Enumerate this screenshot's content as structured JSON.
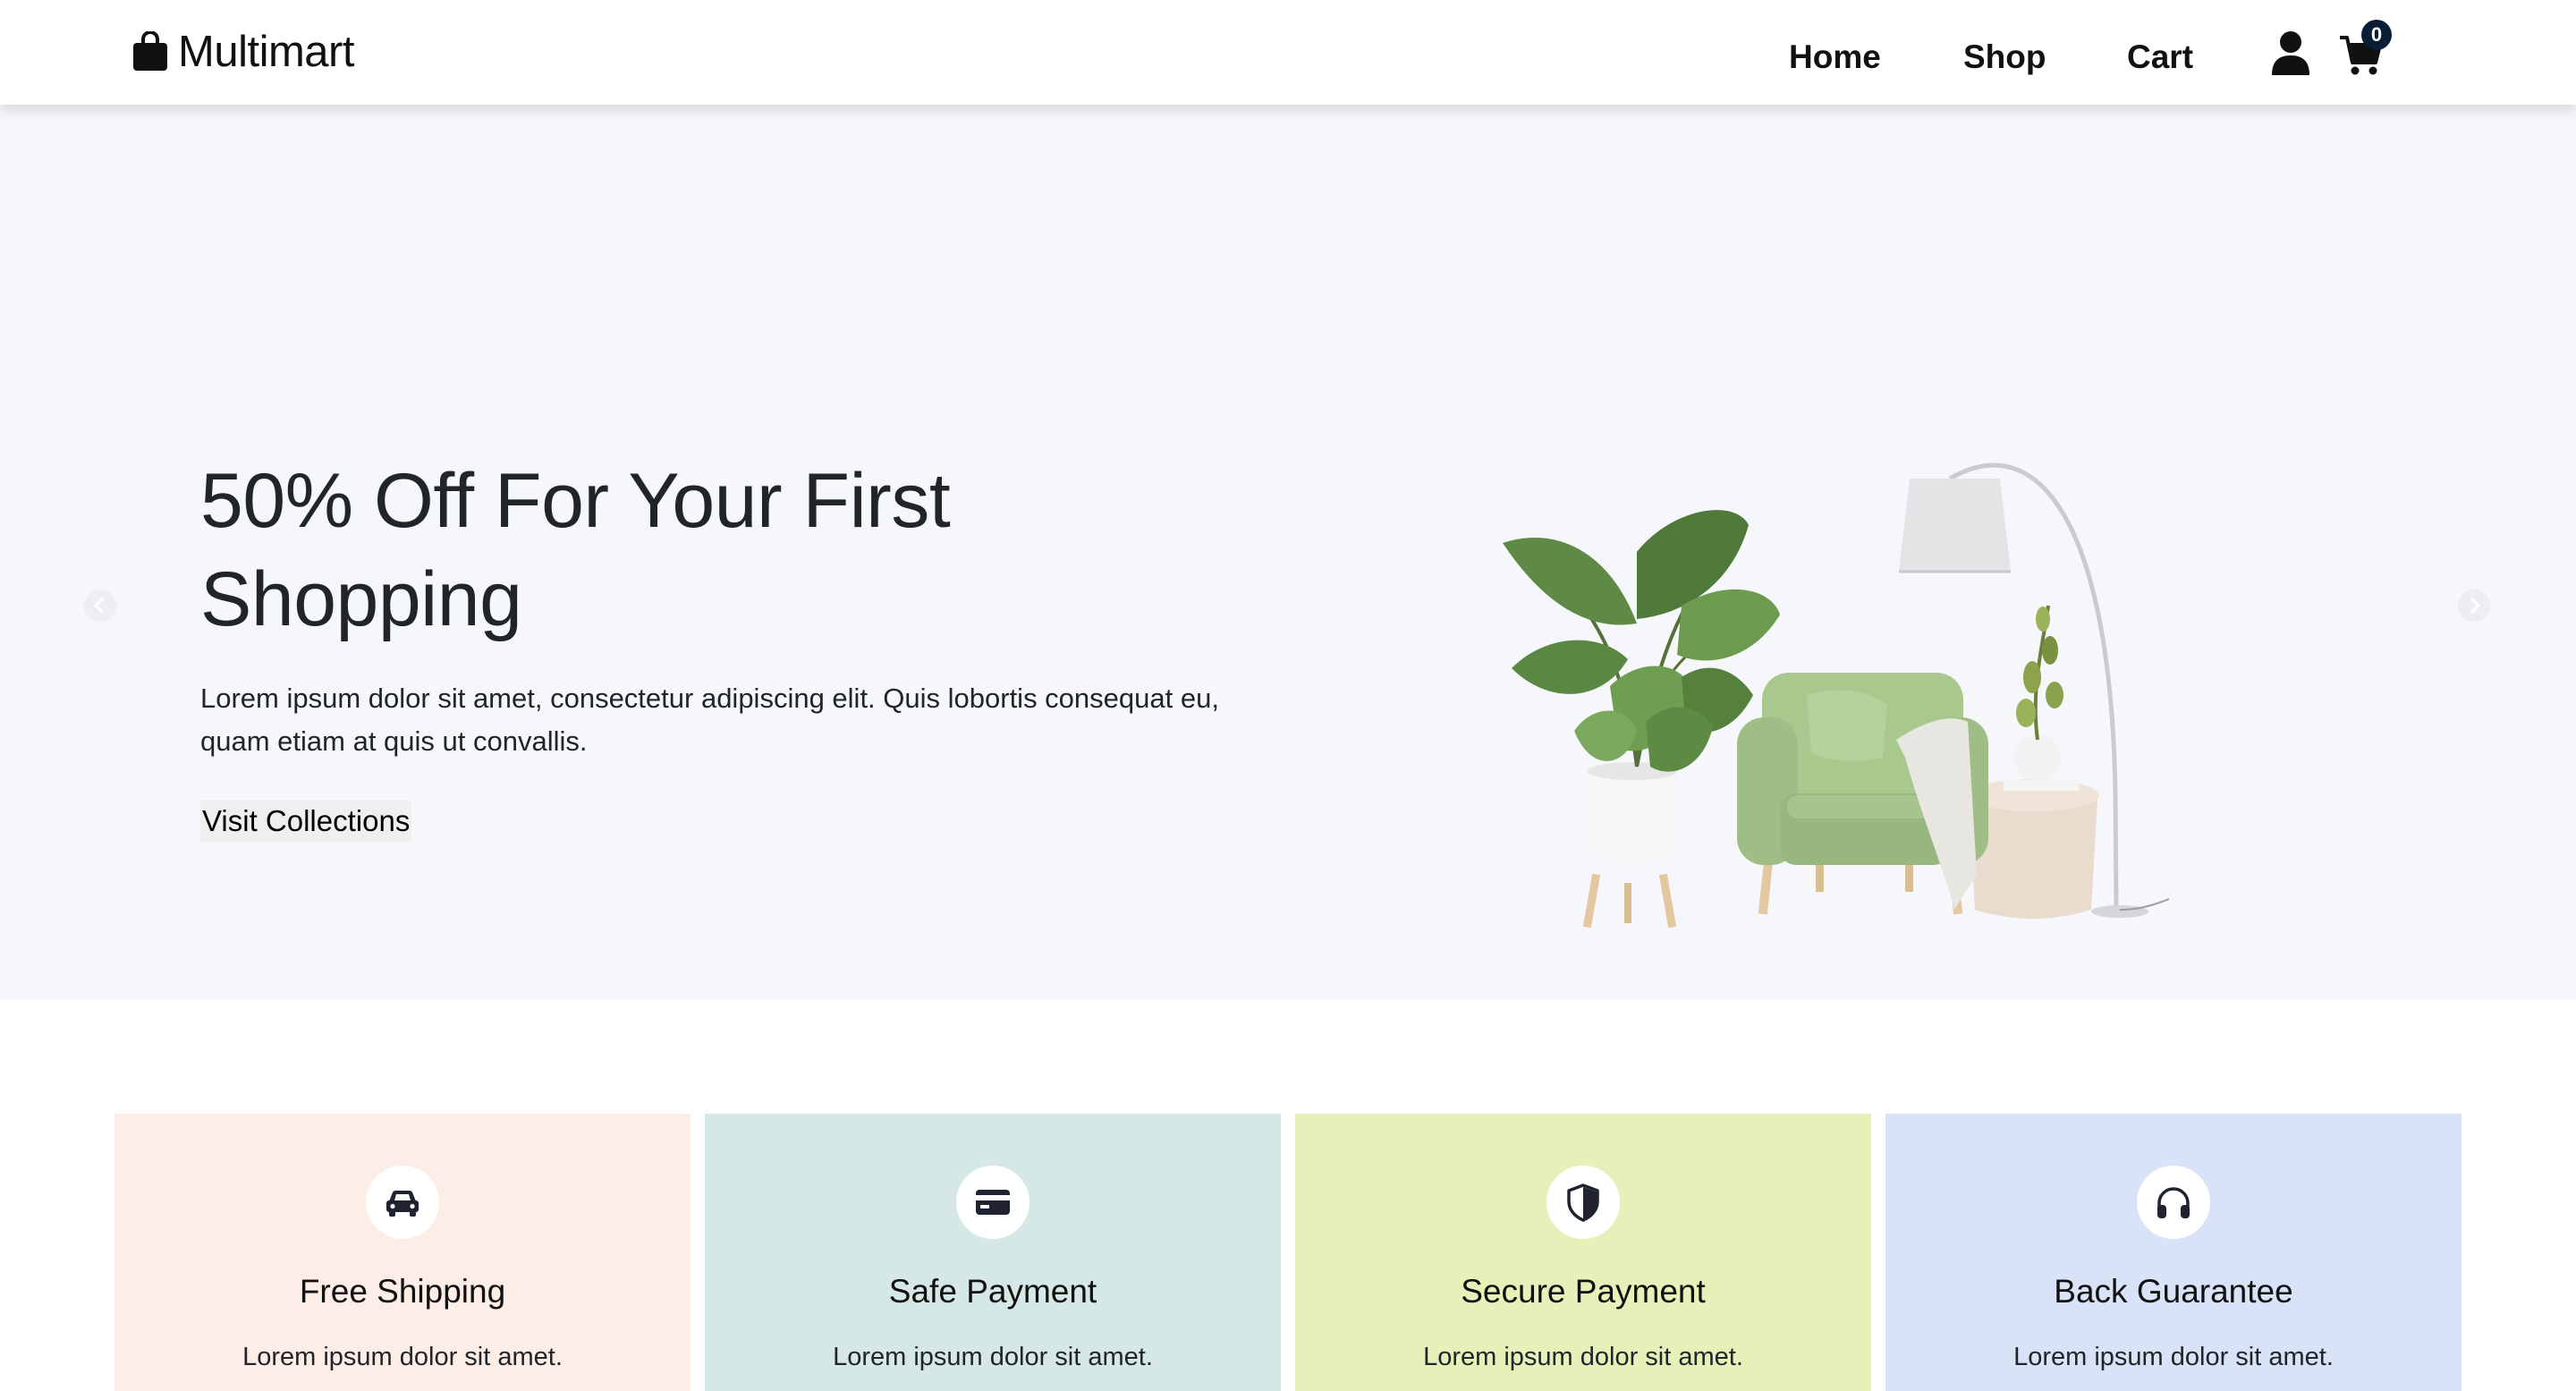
{
  "brand": {
    "name": "Multimart",
    "icon": "shopping-bag-icon"
  },
  "nav": {
    "items": [
      {
        "label": "Home"
      },
      {
        "label": "Shop"
      },
      {
        "label": "Cart"
      }
    ],
    "user_icon": "user-icon",
    "cart_icon": "cart-icon",
    "cart_count": "0"
  },
  "hero": {
    "title": "50% Off For Your First Shopping",
    "description": "Lorem ipsum dolor sit amet, consectetur adipiscing elit. Quis lobortis consequat eu, quam etiam at quis ut convallis.",
    "button_label": "Visit Collections",
    "image_alt": "armchair, plant, floor lamp and side table"
  },
  "services": [
    {
      "title": "Free Shipping",
      "description": "Lorem ipsum dolor sit amet.",
      "icon": "car-icon",
      "bg": "#fcede6"
    },
    {
      "title": "Safe Payment",
      "description": "Lorem ipsum dolor sit amet.",
      "icon": "credit-card-icon",
      "bg": "#d6e8e6"
    },
    {
      "title": "Secure Payment",
      "description": "Lorem ipsum dolor sit amet.",
      "icon": "shield-icon",
      "bg": "#e6f1b9"
    },
    {
      "title": "Back Guarantee",
      "description": "Lorem ipsum dolor sit amet.",
      "icon": "headphones-icon",
      "bg": "#d8e3f7"
    }
  ],
  "colors": {
    "hero_bg": "#f6f7fb",
    "badge_bg": "#0a1d37",
    "text": "#212529"
  }
}
